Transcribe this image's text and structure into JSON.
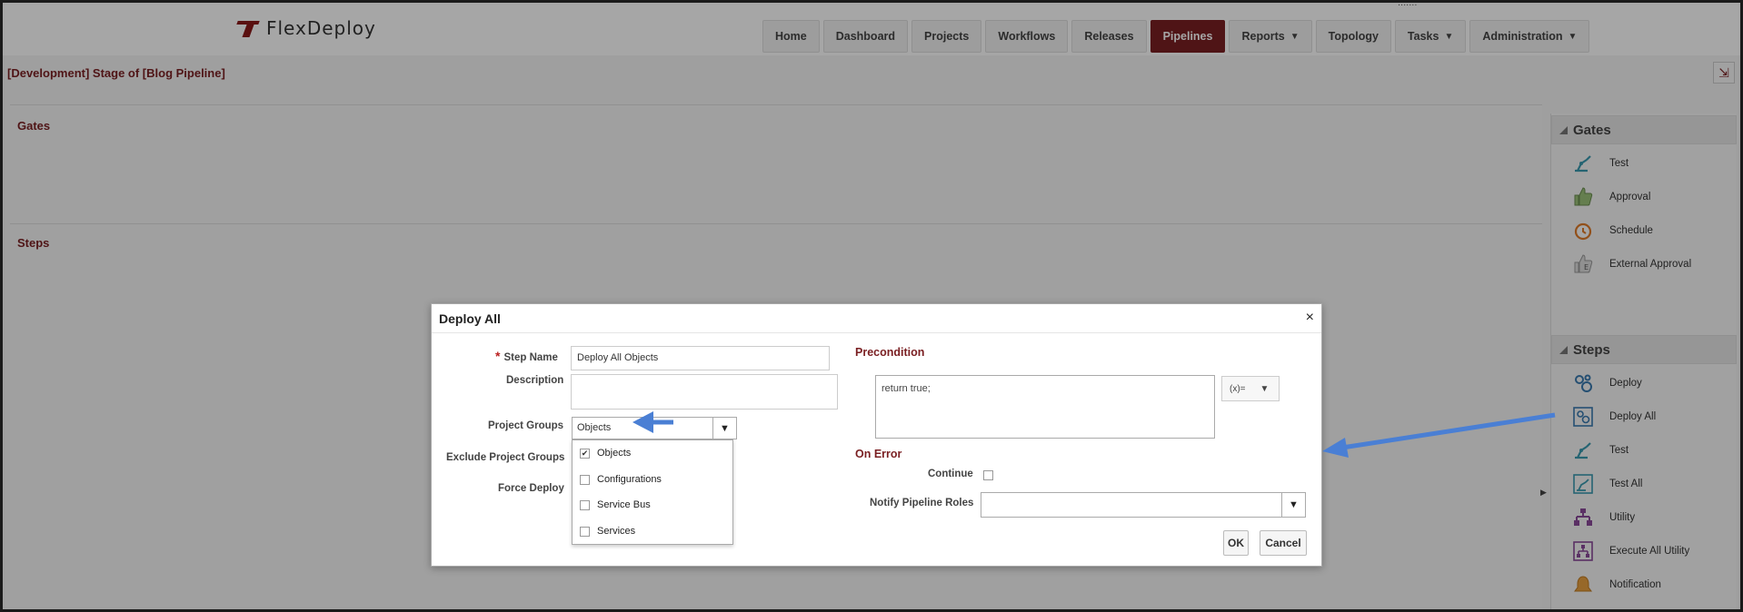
{
  "app": {
    "logo_text": "FlexDeploy",
    "user_info": "......."
  },
  "nav": {
    "items": [
      {
        "label": "Home",
        "caret": false,
        "active": false
      },
      {
        "label": "Dashboard",
        "caret": false,
        "active": false
      },
      {
        "label": "Projects",
        "caret": false,
        "active": false
      },
      {
        "label": "Workflows",
        "caret": false,
        "active": false
      },
      {
        "label": "Releases",
        "caret": false,
        "active": false
      },
      {
        "label": "Pipelines",
        "caret": false,
        "active": true
      },
      {
        "label": "Reports",
        "caret": true,
        "active": false
      },
      {
        "label": "Topology",
        "caret": false,
        "active": false
      },
      {
        "label": "Tasks",
        "caret": true,
        "active": false
      },
      {
        "label": "Administration",
        "caret": true,
        "active": false
      }
    ]
  },
  "page": {
    "title": "[Development] Stage of [Blog Pipeline]",
    "gates_title": "Gates",
    "steps_title": "Steps"
  },
  "palette": {
    "gates_header": "Gates",
    "gates": [
      {
        "label": "Test",
        "icon": "robot-arm-icon"
      },
      {
        "label": "Approval",
        "icon": "thumbs-up-icon"
      },
      {
        "label": "Schedule",
        "icon": "alarm-clock-icon"
      },
      {
        "label": "External Approval",
        "icon": "external-approval-icon"
      }
    ],
    "steps_header": "Steps",
    "steps": [
      {
        "label": "Deploy",
        "icon": "deploy-icon"
      },
      {
        "label": "Deploy All",
        "icon": "deploy-all-icon"
      },
      {
        "label": "Test",
        "icon": "robot-arm-icon"
      },
      {
        "label": "Test All",
        "icon": "test-all-icon"
      },
      {
        "label": "Utility",
        "icon": "utility-icon"
      },
      {
        "label": "Execute All Utility",
        "icon": "execute-all-utility-icon"
      },
      {
        "label": "Notification",
        "icon": "notification-icon"
      }
    ]
  },
  "dialog": {
    "title": "Deploy All",
    "close": "×",
    "step_name_label": "Step Name",
    "step_name_value": "Deploy All Objects",
    "description_label": "Description",
    "description_value": "",
    "project_groups_label": "Project Groups",
    "project_groups_value": "Objects",
    "exclude_project_groups_label": "Exclude Project Groups",
    "force_deploy_label": "Force Deploy",
    "dropdown_options": [
      {
        "label": "Objects",
        "checked": true
      },
      {
        "label": "Configurations",
        "checked": false
      },
      {
        "label": "Service Bus",
        "checked": false
      },
      {
        "label": "Services",
        "checked": false
      }
    ],
    "precondition_title": "Precondition",
    "precondition_value": "return true;",
    "fx_label": "(x)=",
    "on_error_title": "On Error",
    "continue_label": "Continue",
    "notify_roles_label": "Notify Pipeline Roles",
    "notify_roles_value": "",
    "ok_label": "OK",
    "cancel_label": "Cancel"
  },
  "colors": {
    "brand": "#7a1f22",
    "annotation_arrow": "#4a7fd4"
  }
}
